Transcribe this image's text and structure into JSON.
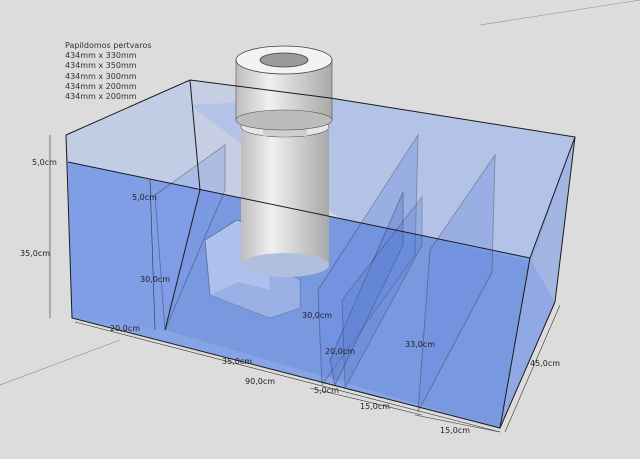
{
  "notes": {
    "title": "Papildomos pertvaros",
    "lines": [
      "434mm x 330mm",
      "434mm x 350mm",
      "434mm x 300mm",
      "434mm x 200mm",
      "434mm x 200mm"
    ]
  },
  "dimensions": {
    "top_glass": "5,0cm",
    "height_total": "35,0cm",
    "inner_top": "5,0cm",
    "inner_height": "30,0cm",
    "left_section": "20,0cm",
    "middle_section": "35,0cm",
    "length_total": "90,0cm",
    "baffle_gap": "5,0cm",
    "chamber_1": "15,0cm",
    "chamber_2": "15,0cm",
    "depth": "45,0cm",
    "baffle_height_1": "30,0cm",
    "baffle_height_2": "20,0cm",
    "baffle_height_3": "33,0cm"
  },
  "colors": {
    "background": "#dcdcdc",
    "water": "#7f9fe6",
    "glass": "#a9bfe6",
    "edge": "#1a1a1a",
    "cylinder": "#d8d8d8"
  }
}
